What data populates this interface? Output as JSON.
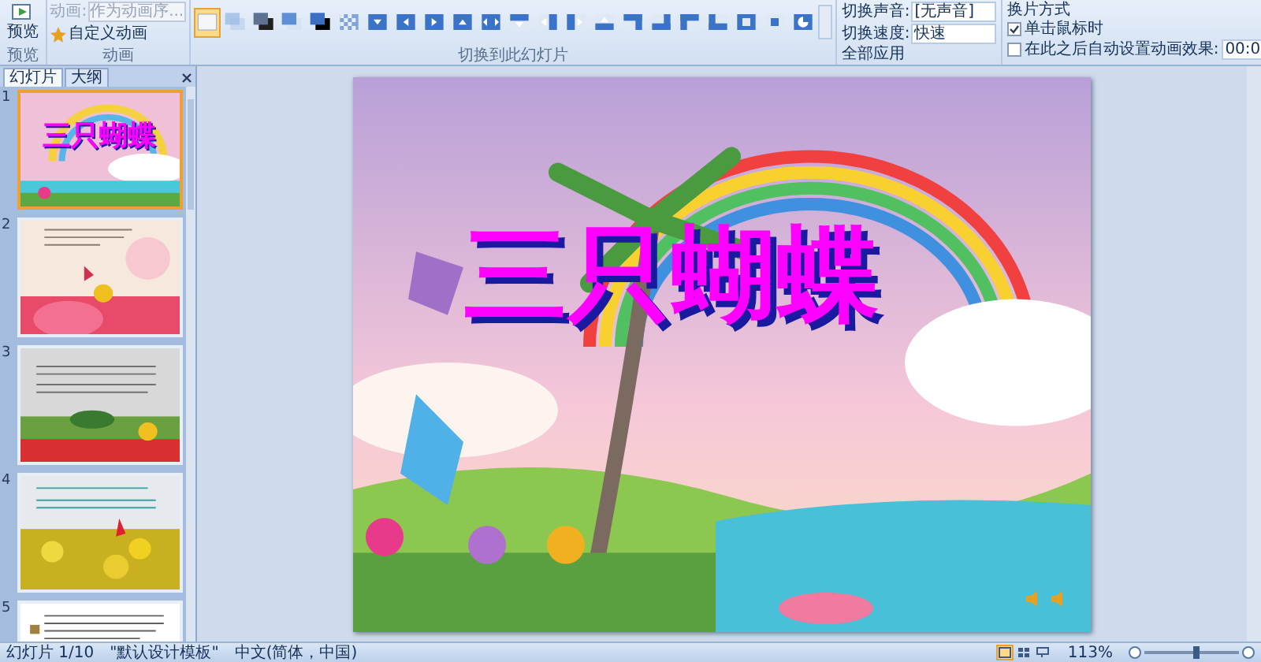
{
  "ribbon": {
    "preview": {
      "label": "预览"
    },
    "animation": {
      "label": "动画:",
      "value": "作为动画序...",
      "disabled": true,
      "custom": "自定义动画"
    },
    "groups": [
      "预览",
      "动画",
      "切换到此幻灯片"
    ],
    "transitions": [
      {
        "kind": "none",
        "selected": true
      },
      {
        "kind": "fade",
        "selected": false
      },
      {
        "kind": "fade-black",
        "selected": false
      },
      {
        "kind": "cut",
        "selected": false
      },
      {
        "kind": "cut-black",
        "selected": false
      },
      {
        "kind": "dissolve",
        "selected": false
      },
      {
        "kind": "wipe-down",
        "selected": false
      },
      {
        "kind": "wipe-left",
        "selected": false
      },
      {
        "kind": "wipe-right",
        "selected": false
      },
      {
        "kind": "wipe-up",
        "selected": false
      },
      {
        "kind": "split",
        "selected": false
      },
      {
        "kind": "cover-down",
        "selected": false
      },
      {
        "kind": "cover-left",
        "selected": false
      },
      {
        "kind": "cover-right",
        "selected": false
      },
      {
        "kind": "cover-up",
        "selected": false
      },
      {
        "kind": "corner-ne",
        "selected": false
      },
      {
        "kind": "corner-se",
        "selected": false
      },
      {
        "kind": "corner-nw",
        "selected": false
      },
      {
        "kind": "corner-sw",
        "selected": false
      },
      {
        "kind": "box-in",
        "selected": false
      },
      {
        "kind": "box-out",
        "selected": false
      },
      {
        "kind": "wheel",
        "selected": false
      }
    ],
    "sound": {
      "label": "切换声音:",
      "value": "[无声音]"
    },
    "speed": {
      "label": "切换速度:",
      "value": "快速"
    },
    "apply_all": "全部应用",
    "advance": {
      "title": "换片方式",
      "on_click": {
        "label": "单击鼠标时",
        "checked": true
      },
      "auto": {
        "label": "在此之后自动设置动画效果:",
        "checked": false,
        "value": "00:0"
      }
    }
  },
  "panel": {
    "tabs": [
      {
        "label": "幻灯片",
        "selected": true
      },
      {
        "label": "大纲",
        "selected": false
      }
    ],
    "slides": [
      {
        "number": "1",
        "selected": true,
        "kind": "title",
        "title": "三只蝴蝶"
      },
      {
        "number": "2",
        "selected": false,
        "kind": "garden"
      },
      {
        "number": "3",
        "selected": false,
        "kind": "meadow"
      },
      {
        "number": "4",
        "selected": false,
        "kind": "flowers"
      },
      {
        "number": "5",
        "selected": false,
        "kind": "text"
      }
    ]
  },
  "slide": {
    "title": "三只蝴蝶"
  },
  "status_bar": {
    "slide": "幻灯片 1/10",
    "theme": "\"默认设计模板\"",
    "language": "中文(简体，中国)",
    "views": [
      {
        "kind": "normal",
        "selected": true
      },
      {
        "kind": "sorter",
        "selected": false
      },
      {
        "kind": "show",
        "selected": false
      }
    ],
    "zoom": "113%",
    "zoom_slider": {
      "level": 0.55
    }
  }
}
